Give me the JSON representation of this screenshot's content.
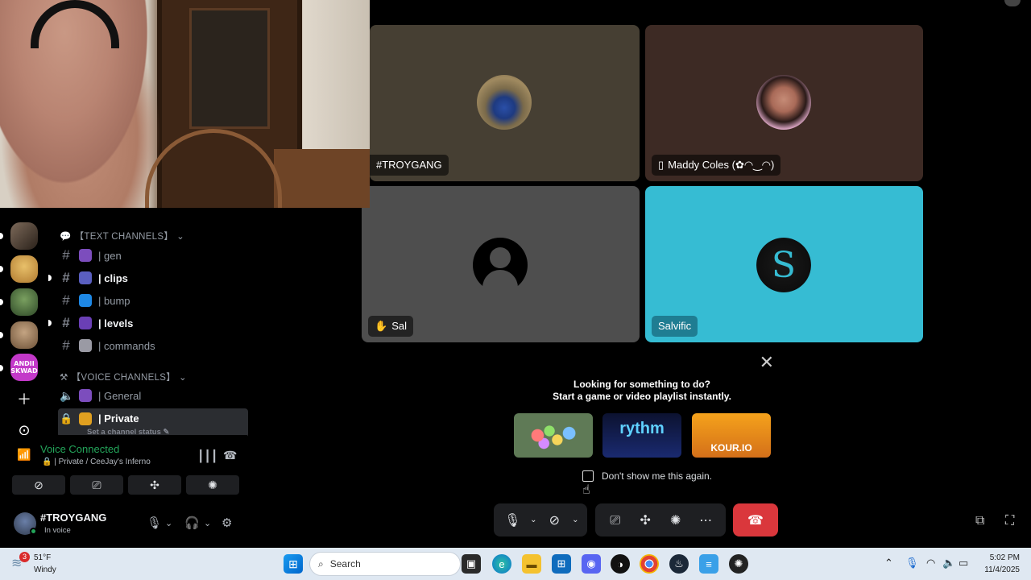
{
  "tiles": [
    {
      "name": "#TROYGANG"
    },
    {
      "name": "Maddy Coles (✿◠‿◠)"
    },
    {
      "name": "Sal"
    },
    {
      "name": "Salvific"
    }
  ],
  "activity": {
    "line1": "Looking for something to do?",
    "line2": "Start a game or video playlist instantly.",
    "games": [
      "",
      "rythm",
      "KOUR.IO"
    ],
    "dont_show": "Don't show me this again."
  },
  "channels": {
    "text_category": "【TEXT CHANNELS】",
    "voice_category": "【VOICE CHANNELS】",
    "text": [
      {
        "label": "| gen"
      },
      {
        "label": "| clips"
      },
      {
        "label": "| bump"
      },
      {
        "label": "| levels"
      },
      {
        "label": "| commands"
      }
    ],
    "voice": [
      {
        "label": "| General"
      },
      {
        "label": "| Private",
        "status": "Set a channel status"
      }
    ]
  },
  "servers": {
    "andii_label": "ANDII SKWAD"
  },
  "voice_panel": {
    "status": "Voice Connected",
    "location": "| Private / CeeJay's Inferno"
  },
  "user": {
    "name": "#TROYGANG",
    "status": "In voice"
  },
  "taskbar": {
    "weather_badge": "3",
    "temp": "51°F",
    "condition": "Windy",
    "search_placeholder": "Search",
    "time": "5:02 PM",
    "date": "11/4/2025"
  },
  "colors": {
    "accent_green": "#23a55a",
    "danger_red": "#da373c",
    "salvific_bg": "#36bcd3"
  }
}
